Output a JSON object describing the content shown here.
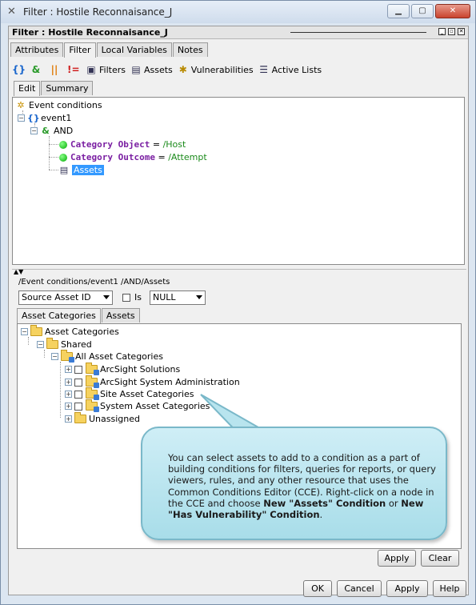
{
  "window": {
    "title": "Filter : Hostile Reconnaisance_J"
  },
  "panel": {
    "title": "Filter : Hostile Reconnaisance_J"
  },
  "top_tabs": [
    "Attributes",
    "Filter",
    "Local Variables",
    "Notes"
  ],
  "toolbar": {
    "filters": "Filters",
    "assets": "Assets",
    "vulnerabilities": "Vulnerabilities",
    "active_lists": "Active Lists"
  },
  "sub_tabs": [
    "Edit",
    "Summary"
  ],
  "condition_tree": {
    "root": "Event conditions",
    "event": "event1",
    "and": "AND",
    "cond1_key": "Category Object",
    "cond1_op": " = ",
    "cond1_val": "/Host",
    "cond2_key": "Category Outcome",
    "cond2_op": " = ",
    "cond2_val": "/Attempt",
    "assets": "Assets"
  },
  "path_label": "/Event conditions/event1 /AND/Assets",
  "source_select": "Source Asset ID",
  "is_label": "Is",
  "null_select": "NULL",
  "asset_tabs": [
    "Asset Categories",
    "Assets"
  ],
  "asset_tree": {
    "root": "Asset Categories",
    "shared": "Shared",
    "all": "All Asset Categories",
    "items": [
      "ArcSight Solutions",
      "ArcSight System Administration",
      "Site Asset Categories",
      "System Asset Categories",
      "Unassigned"
    ]
  },
  "callout": {
    "line1": "You can select assets to add to a condition as a part of building conditions for filters, queries for reports, or query viewers, rules, and any other resource that uses the Common Conditions Editor (CCE). Right-click on a node in the CCE and choose ",
    "bold1": "New \"Assets\" Condition",
    "mid": " or ",
    "bold2": "New \"Has Vulnerability\" Condition",
    "end": "."
  },
  "inner_buttons": {
    "apply": "Apply",
    "clear": "Clear"
  },
  "bottom_buttons": {
    "ok": "OK",
    "cancel": "Cancel",
    "apply": "Apply",
    "help": "Help"
  }
}
